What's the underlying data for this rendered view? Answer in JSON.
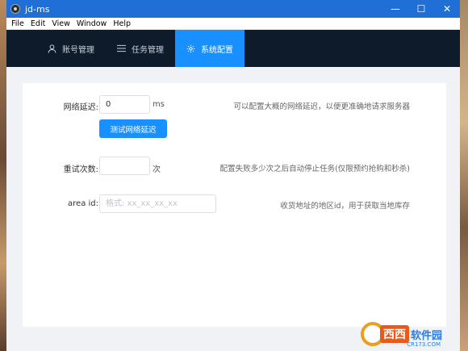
{
  "window": {
    "title": "jd-ms"
  },
  "controls": {
    "minimize": "—",
    "maximize": "☐",
    "close": "✕"
  },
  "menu": [
    "File",
    "Edit",
    "View",
    "Window",
    "Help"
  ],
  "nav": {
    "tabs": [
      {
        "label": "账号管理",
        "icon": "user-icon",
        "active": false
      },
      {
        "label": "任务管理",
        "icon": "list-icon",
        "active": false
      },
      {
        "label": "系统配置",
        "icon": "gear-icon",
        "active": true
      }
    ],
    "accent": "#1890ff",
    "background": "#0d1b2a"
  },
  "form": {
    "latency": {
      "label": "网络延迟:",
      "value": "0",
      "unit": "ms",
      "description": "可以配置大概的网络延迟，以便更准确地请求服务器",
      "test_button": "测试网络延迟"
    },
    "retry": {
      "label": "重试次数:",
      "value": "",
      "unit": "次",
      "description": "配置失败多少次之后自动停止任务(仅限预约抢购和秒杀)"
    },
    "area": {
      "label": "area id:",
      "placeholder": "格式: xx_xx_xx_xx",
      "description": "收货地址的地区id，用于获取当地库存"
    }
  },
  "watermark": {
    "brand": "西西",
    "text": "软件园",
    "site": "CR173.COM"
  }
}
